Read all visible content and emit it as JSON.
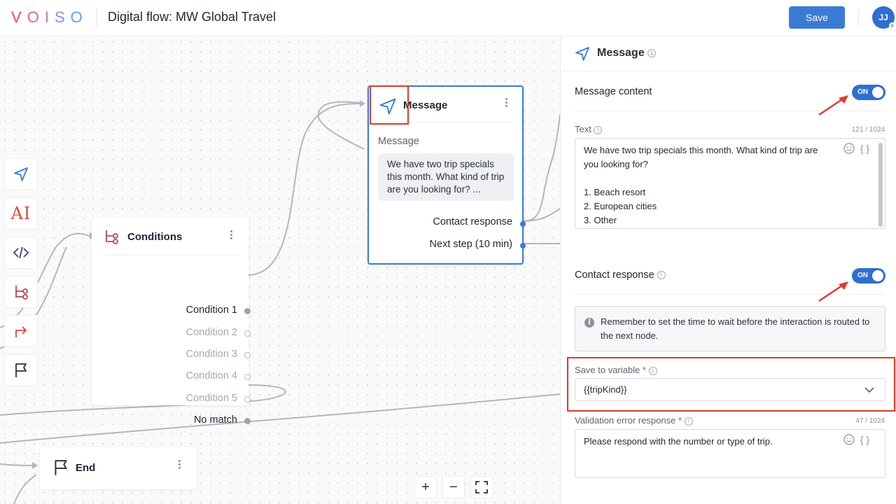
{
  "header": {
    "logo_letters": [
      "V",
      "O",
      "I",
      "S",
      "O"
    ],
    "logo_colors": [
      "#e8417c",
      "#e36095",
      "#c178c8",
      "#8b8fe0",
      "#5aa3e8"
    ],
    "title": "Digital flow: MW Global Travel",
    "save_label": "Save",
    "avatar_initials": "JJ"
  },
  "toolbox": {
    "items": [
      "send-icon",
      "ai-icon",
      "code-icon",
      "conditions-icon",
      "redirect-icon",
      "flag-icon"
    ],
    "ai_label": "AI"
  },
  "conditions_node": {
    "title": "Conditions",
    "rows": [
      {
        "label": "Condition 1",
        "active": true
      },
      {
        "label": "Condition 2",
        "active": false
      },
      {
        "label": "Condition 3",
        "active": false
      },
      {
        "label": "Condition 4",
        "active": false
      },
      {
        "label": "Condition 5",
        "active": false
      },
      {
        "label": "No match",
        "active": true
      }
    ]
  },
  "message_node": {
    "title": "Message",
    "label": "Message",
    "preview": "We have two trip specials this month. What kind of trip are you looking for? ...",
    "outputs": [
      "Contact response",
      "Next step (10 min)"
    ]
  },
  "end_node": {
    "title": "End"
  },
  "zoom_controls": [
    "+",
    "−"
  ],
  "panel": {
    "title": "Message",
    "message_content_label": "Message content",
    "message_content_toggle": "ON",
    "text_label": "Text",
    "text_counter": "121 / 1024",
    "text_value": "We have two trip specials this month. What kind of trip are\nyou looking for?\n\n1. Beach resort\n2. European cities\n3. Other",
    "variable_icon": "{ }",
    "contact_response_label": "Contact response",
    "contact_response_toggle": "ON",
    "notice": "Remember to set the time to wait before the interaction is routed to the next node.",
    "save_to_variable_label": "Save to variable",
    "save_to_variable_value": "{{tripKind}}",
    "required_mark": "*",
    "validation_label": "Validation error response",
    "validation_counter": "47 / 1024",
    "validation_value": "Please respond with the number or type of trip."
  },
  "colors": {
    "accent": "#3a7bd5",
    "annotation_red": "#e03a2f",
    "conditions_icon": "#c0444e"
  }
}
